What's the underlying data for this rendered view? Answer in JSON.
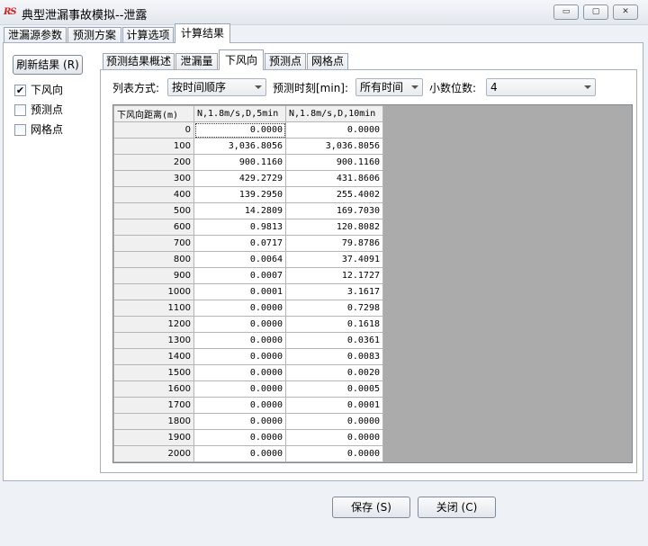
{
  "window": {
    "logo": "RS",
    "title": "典型泄漏事故模拟--泄露",
    "minimize_glyph": "▭",
    "maximize_glyph": "▢",
    "close_glyph": "✕"
  },
  "outer_tabs": [
    {
      "label": "泄漏源参数",
      "active": false
    },
    {
      "label": "预测方案",
      "active": false
    },
    {
      "label": "计算选项",
      "active": false
    },
    {
      "label": "计算结果",
      "active": true
    }
  ],
  "left_panel": {
    "refresh_label": "刷新结果 (R)",
    "checks": [
      {
        "label": "下风向",
        "checked": true
      },
      {
        "label": "预测点",
        "checked": false
      },
      {
        "label": "网格点",
        "checked": false
      }
    ]
  },
  "inner_tabs": [
    {
      "label": "预测结果概述",
      "active": false
    },
    {
      "label": "泄漏量",
      "active": false
    },
    {
      "label": "下风向",
      "active": true
    },
    {
      "label": "预测点",
      "active": false
    },
    {
      "label": "网格点",
      "active": false
    }
  ],
  "options": {
    "list_mode_label": "列表方式:",
    "list_mode_value": "按时间顺序",
    "time_label": "预测时刻[min]:",
    "time_value": "所有时间",
    "decimals_label": "小数位数:",
    "decimals_value": "4"
  },
  "table": {
    "headers": [
      "下风向距离(m)",
      "N,1.8m/s,D,5min",
      "N,1.8m/s,D,10min"
    ],
    "rows": [
      [
        "0",
        "0.0000",
        "0.0000"
      ],
      [
        "100",
        "3,036.8056",
        "3,036.8056"
      ],
      [
        "200",
        "900.1160",
        "900.1160"
      ],
      [
        "300",
        "429.2729",
        "431.8606"
      ],
      [
        "400",
        "139.2950",
        "255.4002"
      ],
      [
        "500",
        "14.2809",
        "169.7030"
      ],
      [
        "600",
        "0.9813",
        "120.8082"
      ],
      [
        "700",
        "0.0717",
        "79.8786"
      ],
      [
        "800",
        "0.0064",
        "37.4091"
      ],
      [
        "900",
        "0.0007",
        "12.1727"
      ],
      [
        "1000",
        "0.0001",
        "3.1617"
      ],
      [
        "1100",
        "0.0000",
        "0.7298"
      ],
      [
        "1200",
        "0.0000",
        "0.1618"
      ],
      [
        "1300",
        "0.0000",
        "0.0361"
      ],
      [
        "1400",
        "0.0000",
        "0.0083"
      ],
      [
        "1500",
        "0.0000",
        "0.0020"
      ],
      [
        "1600",
        "0.0000",
        "0.0005"
      ],
      [
        "1700",
        "0.0000",
        "0.0001"
      ],
      [
        "1800",
        "0.0000",
        "0.0000"
      ],
      [
        "1900",
        "0.0000",
        "0.0000"
      ],
      [
        "2000",
        "0.0000",
        "0.0000"
      ]
    ]
  },
  "buttons": {
    "save_label": "保存 (S)",
    "close_label": "关闭 (C)"
  }
}
